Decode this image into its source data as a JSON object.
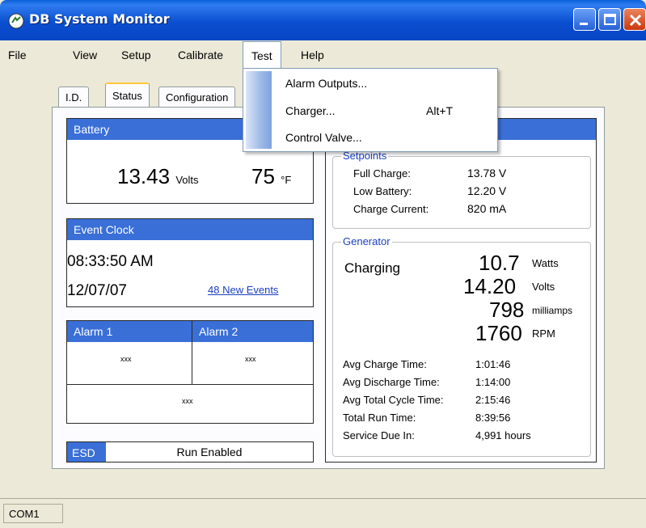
{
  "window": {
    "title": "DB System Monitor"
  },
  "menu": [
    "File",
    "View",
    "Setup",
    "Calibrate",
    "Test",
    "Help"
  ],
  "test_menu": {
    "items": [
      {
        "label": "Alarm Outputs...",
        "shortcut": ""
      },
      {
        "label": "Charger...",
        "shortcut": "Alt+T"
      },
      {
        "label": "Control Valve...",
        "shortcut": ""
      }
    ]
  },
  "tabs": [
    "I.D.",
    "Status",
    "Configuration"
  ],
  "battery": {
    "header": "Battery",
    "volts": "13.43",
    "volts_unit": "Volts",
    "temp": "75",
    "temp_unit": "°F"
  },
  "event_clock": {
    "header": "Event Clock",
    "time": "08:33:50 AM",
    "date": "12/07/07",
    "events_link": "48 New Events"
  },
  "alarms": {
    "alarm1_header": "Alarm 1",
    "alarm2_header": "Alarm 2",
    "alarm1_value": "xxx",
    "alarm2_value": "xxx",
    "bottom_value": "xxx"
  },
  "esd": {
    "label": "ESD",
    "value": "Run Enabled"
  },
  "setpoints": {
    "label": "Setpoints",
    "rows": [
      {
        "name": "Full Charge:",
        "value": "13.78 V"
      },
      {
        "name": "Low Battery:",
        "value": "12.20 V"
      },
      {
        "name": "Charge Current:",
        "value": "820 mA"
      }
    ]
  },
  "generator": {
    "label": "Generator",
    "state": "Charging",
    "readings": [
      {
        "value": "10.7",
        "unit": "Watts"
      },
      {
        "value": "14.20",
        "unit": "Volts"
      },
      {
        "value": "798",
        "unit": "milliamps"
      },
      {
        "value": "1760",
        "unit": "RPM"
      }
    ],
    "stats": [
      {
        "name": "Avg Charge Time:",
        "value": "1:01:46"
      },
      {
        "name": "Avg Discharge Time:",
        "value": "1:14:00"
      },
      {
        "name": "Avg Total Cycle Time:",
        "value": "2:15:46"
      },
      {
        "name": "Total Run Time:",
        "value": "8:39:56"
      },
      {
        "name": "Service Due In:",
        "value": "4,991 hours"
      }
    ]
  },
  "statusbar": {
    "port": "COM1"
  },
  "colors": {
    "header_blue": "#3a6fd8",
    "link_blue": "#1a3fc0",
    "titlebar_blue": "#0a4fd0"
  }
}
